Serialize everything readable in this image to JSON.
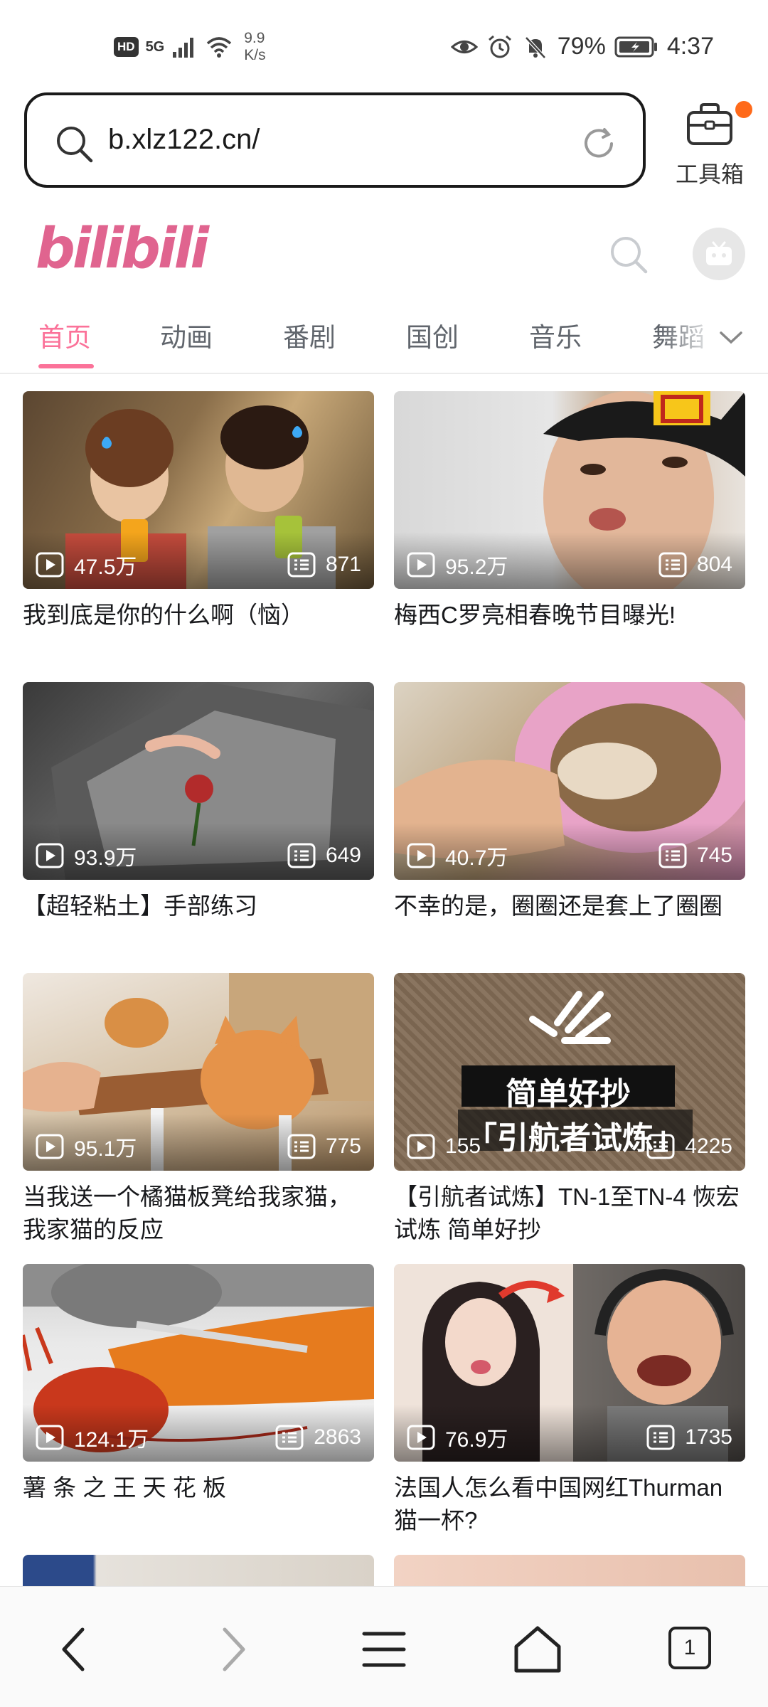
{
  "status_bar": {
    "hd": "HD",
    "network": "5G",
    "speed_value": "9.9",
    "speed_unit": "K/s",
    "battery": "79%",
    "time": "4:37"
  },
  "browser": {
    "url": "b.xlz122.cn/",
    "toolbox_label": "工具箱",
    "tab_count": "1"
  },
  "site": {
    "logo_text": "bilibili",
    "accent_color": "#fb7299"
  },
  "tabs": [
    {
      "label": "首页"
    },
    {
      "label": "动画"
    },
    {
      "label": "番剧"
    },
    {
      "label": "国创"
    },
    {
      "label": "音乐"
    },
    {
      "label": "舞蹈"
    }
  ],
  "videos": [
    {
      "views": "47.5万",
      "comments": "871",
      "title": "我到底是你的什么啊（恼）"
    },
    {
      "views": "95.2万",
      "comments": "804",
      "title": "梅西C罗亮相春晚节目曝光!"
    },
    {
      "views": "93.9万",
      "comments": "649",
      "title": "【超轻粘土】手部练习"
    },
    {
      "views": "40.7万",
      "comments": "745",
      "title": "不幸的是，圈圈还是套上了圈圈"
    },
    {
      "views": "95.1万",
      "comments": "775",
      "title": "当我送一个橘猫板凳给我家猫，我家猫的反应"
    },
    {
      "views": "155",
      "comments": "4225",
      "title": "【引航者试炼】TN-1至TN-4 恢宏试炼 简单好抄",
      "overlay_top": "简单好抄",
      "overlay_bottom": "「引航者试炼」"
    },
    {
      "views": "124.1万",
      "comments": "2863",
      "title": "薯 条 之 王 天 花 板"
    },
    {
      "views": "76.9万",
      "comments": "1735",
      "title": "法国人怎么看中国网红Thurman猫一杯?"
    }
  ]
}
